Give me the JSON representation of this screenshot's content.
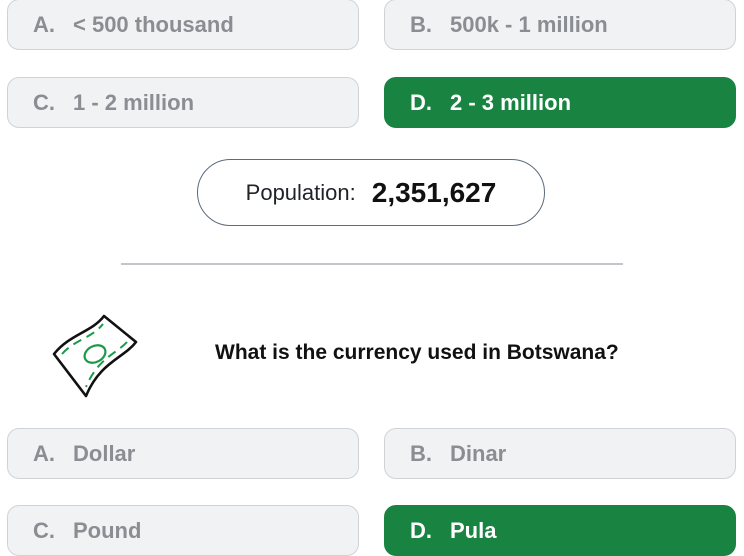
{
  "previous_question": {
    "options": [
      {
        "letter": "A.",
        "text": "< 500 thousand"
      },
      {
        "letter": "B.",
        "text": "500k - 1 million"
      },
      {
        "letter": "C.",
        "text": "1 - 2 million"
      },
      {
        "letter": "D.",
        "text": "2 - 3 million"
      }
    ],
    "correct_option": "D",
    "population_label": "Population:",
    "population_value": "2,351,627"
  },
  "current_question": {
    "icon": "money-bill-icon",
    "text": "What is the currency used in Botswana?",
    "options": [
      {
        "letter": "A.",
        "text": "Dollar"
      },
      {
        "letter": "B.",
        "text": "Dinar"
      },
      {
        "letter": "C.",
        "text": "Pound"
      },
      {
        "letter": "D.",
        "text": "Pula"
      }
    ],
    "correct_option": "D"
  },
  "colors": {
    "correct": "#198441",
    "option_bg": "#f1f2f4",
    "option_text": "#8a8e93",
    "money_green": "#1a9a49"
  }
}
